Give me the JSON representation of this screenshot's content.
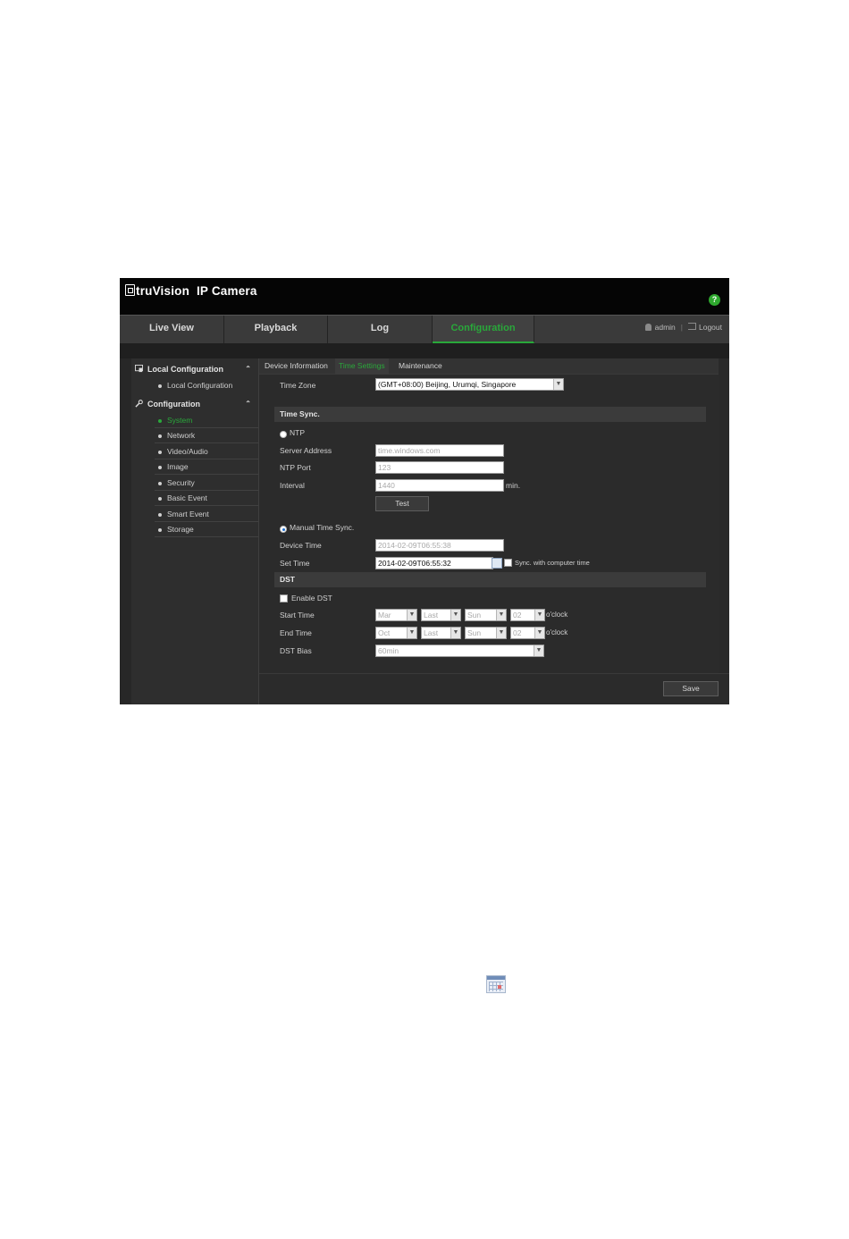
{
  "app": {
    "brand": "truVision",
    "product": "IP Camera"
  },
  "nav": {
    "tabs": [
      {
        "label": "Live View"
      },
      {
        "label": "Playback"
      },
      {
        "label": "Log"
      },
      {
        "label": "Configuration"
      }
    ],
    "active_tab": "Configuration",
    "user": "admin",
    "logout": "Logout"
  },
  "sidebar": {
    "local_header": "Local Configuration",
    "local_items": [
      {
        "label": "Local Configuration"
      }
    ],
    "config_header": "Configuration",
    "config_items": [
      {
        "label": "System"
      },
      {
        "label": "Network"
      },
      {
        "label": "Video/Audio"
      },
      {
        "label": "Image"
      },
      {
        "label": "Security"
      },
      {
        "label": "Basic Event"
      },
      {
        "label": "Smart Event"
      },
      {
        "label": "Storage"
      }
    ],
    "active_item": "System"
  },
  "subtabs": [
    {
      "label": "Device Information"
    },
    {
      "label": "Time Settings"
    },
    {
      "label": "Maintenance"
    }
  ],
  "active_subtab": "Time Settings",
  "form": {
    "time_zone_label": "Time Zone",
    "time_zone_value": "(GMT+08:00) Beijing, Urumqi, Singapore",
    "time_sync_title": "Time Sync.",
    "ntp_label": "NTP",
    "server_address_label": "Server Address",
    "server_address_value": "time.windows.com",
    "ntp_port_label": "NTP Port",
    "ntp_port_value": "123",
    "interval_label": "Interval",
    "interval_value": "1440",
    "interval_unit": "min.",
    "test_button": "Test",
    "manual_sync_label": "Manual Time Sync.",
    "device_time_label": "Device Time",
    "device_time_value": "2014-02-09T06:55:38",
    "set_time_label": "Set Time",
    "set_time_value": "2014-02-09T06:55:32",
    "sync_computer_label": "Sync. with computer time",
    "dst_title": "DST",
    "enable_dst_label": "Enable DST",
    "start_time_label": "Start Time",
    "start": {
      "month": "Mar",
      "week": "Last",
      "day": "Sun",
      "hour": "02"
    },
    "end_time_label": "End Time",
    "end": {
      "month": "Oct",
      "week": "Last",
      "day": "Sun",
      "hour": "02"
    },
    "oclock": "o'clock",
    "dst_bias_label": "DST Bias",
    "dst_bias_value": "60min",
    "save_button": "Save"
  },
  "colors": {
    "accent": "#2aa83b",
    "header_bg": "#050505",
    "panel_bg": "#2b2b2b"
  },
  "icons": {
    "help": "help-icon",
    "user": "user-icon",
    "logout": "logout-icon",
    "local_config": "monitor-icon",
    "configuration": "wrench-icon",
    "calendar": "calendar-icon"
  }
}
